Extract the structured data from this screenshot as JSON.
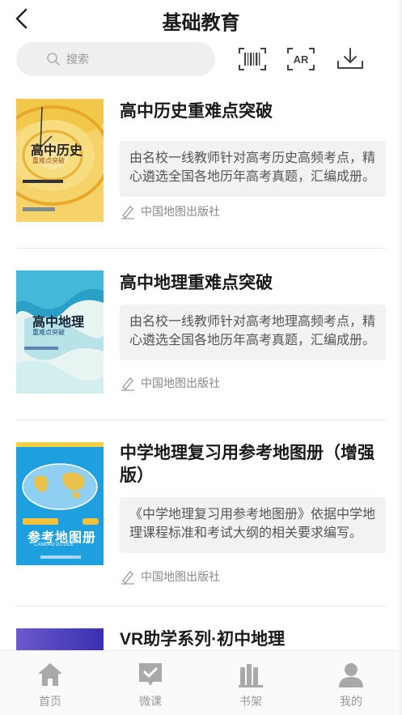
{
  "header": {
    "title": "基础教育"
  },
  "search": {
    "placeholder": "搜索"
  },
  "books": [
    {
      "title": "高中历史重难点突破",
      "description": "由名校一线教师针对高考历史高频考点，精心遴选全国各地历年高考真题，汇编成册。",
      "publisher": "中国地图出版社",
      "cover": {
        "main": "高中历史",
        "sub": "重难点突破"
      }
    },
    {
      "title": "高中地理重难点突破",
      "description": "由名校一线教师针对高考地理高频考点，精心遴选全国各地历年高考真题，汇编成册。",
      "publisher": "中国地图出版社",
      "cover": {
        "main": "高中地理",
        "sub": "重难点突破"
      }
    },
    {
      "title": "中学地理复习用参考地图册（增强版）",
      "description": "《中学地理复习用参考地图册》依据中学地理课程标准和考试大纲的相关要求编写。",
      "publisher": "中国地图出版社",
      "cover": {
        "main": "参考地图册",
        "sub": "CANKAO DITUCE"
      }
    },
    {
      "title": "VR助学系列·初中地理"
    }
  ],
  "tabs": [
    {
      "label": "首页",
      "icon": "home-icon"
    },
    {
      "label": "微课",
      "icon": "microlesson-icon"
    },
    {
      "label": "书架",
      "icon": "bookshelf-icon"
    },
    {
      "label": "我的",
      "icon": "profile-icon"
    }
  ]
}
